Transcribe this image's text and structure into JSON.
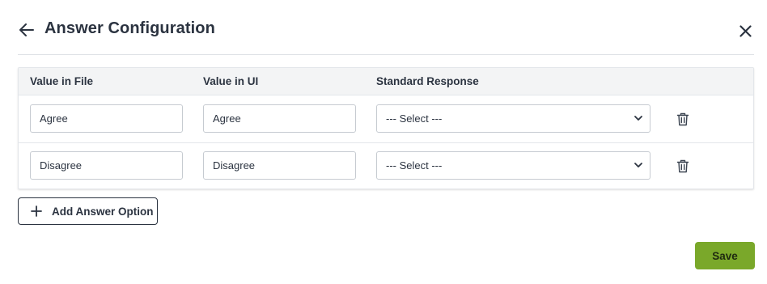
{
  "header": {
    "title": "Answer Configuration",
    "back_icon": "arrow-left-icon",
    "close_icon": "close-icon"
  },
  "table": {
    "columns": [
      "Value in File",
      "Value in UI",
      "Standard Response"
    ],
    "rows": [
      {
        "value_in_file": "Agree",
        "value_in_ui": "Agree",
        "standard_response": "--- Select ---"
      },
      {
        "value_in_file": "Disagree",
        "value_in_ui": "Disagree",
        "standard_response": "--- Select ---"
      }
    ],
    "delete_icon": "trash-icon"
  },
  "actions": {
    "add_option_label": "Add Answer Option",
    "save_label": "Save"
  },
  "colors": {
    "accent": "#7aa82a",
    "text": "#2b3340",
    "header_bg": "#f3f4f5",
    "border": "#c6cbd1"
  }
}
